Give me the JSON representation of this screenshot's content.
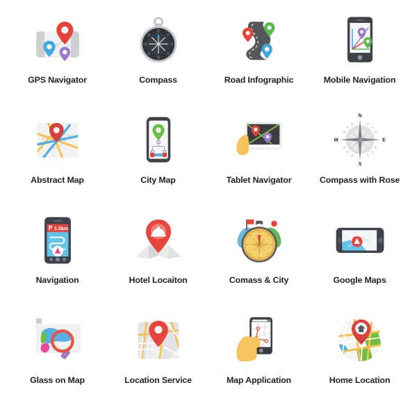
{
  "grid": {
    "columns": 4,
    "rows": 4,
    "background_color": "#ffffff",
    "label_color": "#231f20"
  },
  "icons": [
    {
      "label": "GPS Navigator",
      "icon_name": "gps-navigator-icon",
      "description": "Folded paper map with three location pins",
      "colors": [
        "#E8413A",
        "#3FA9E0",
        "#9B7CC4",
        "#EEEFF0",
        "#C9CCCF"
      ]
    },
    {
      "label": "Compass",
      "icon_name": "compass-icon",
      "description": "Dark round pocket compass with silver rim and hanging ring",
      "colors": [
        "#2E3338",
        "#C6CACD",
        "#3C93D8"
      ]
    },
    {
      "label": "Road Infographic",
      "icon_name": "road-infographic-icon",
      "description": "Winding grey road with red, green and blue pins",
      "colors": [
        "#54585C",
        "#E8413A",
        "#5BBA47",
        "#3FA9E0"
      ]
    },
    {
      "label": "Mobile Navigation",
      "icon_name": "mobile-navigation-icon",
      "description": "Dark smartphone showing route lines with purple and green pins",
      "colors": [
        "#3E4349",
        "#F5F6F7",
        "#9B7CC4",
        "#5BBA47",
        "#E8413A"
      ]
    },
    {
      "label": "Abstract Map",
      "icon_name": "abstract-map-icon",
      "description": "Street map tile with yellow and blue roads and a red pin",
      "colors": [
        "#F2F2F1",
        "#F6C14B",
        "#56AEE2",
        "#D8413C"
      ]
    },
    {
      "label": "City Map",
      "icon_name": "city-map-icon",
      "description": "Smartphone showing a green pin over a transit diagram",
      "colors": [
        "#3E4349",
        "#6CBE45",
        "#56AEE2",
        "#E8413A",
        "#9B7CC4"
      ]
    },
    {
      "label": "Tablet Navigator",
      "icon_name": "tablet-navigator-icon",
      "description": "Hand touching a tablet with a route and two pins",
      "colors": [
        "#3A3E43",
        "#F7C35C",
        "#E8413A",
        "#9B7CC4",
        "#8CC63F"
      ]
    },
    {
      "label": "Compass with Rose",
      "icon_name": "compass-with-rose-icon",
      "description": "Grayscale compass rose with N E S W markings",
      "colors": [
        "#D7D8DA",
        "#808285",
        "#231f20"
      ]
    },
    {
      "label": "Navigation",
      "icon_name": "navigation-icon",
      "description": "Smartphone with turn banner, route path and direction arrow",
      "colors": [
        "#3E4349",
        "#E8413A",
        "#62C3E8",
        "#E8479B"
      ],
      "screen_text": "1.5km"
    },
    {
      "label": "Hotel Locaiton",
      "icon_name": "hotel-location-icon",
      "description": "Red pin with food cloche over a folded white map",
      "colors": [
        "#E8453F",
        "#E9EAEB",
        "#CED1D4"
      ]
    },
    {
      "label": "Comass & City",
      "icon_name": "compass-and-city-icon",
      "description": "Golden compass in front of blue and green land shapes with a red flag",
      "colors": [
        "#F4D06A",
        "#E0B54F",
        "#6FB7DD",
        "#63B75B",
        "#E8413A",
        "#58595B"
      ]
    },
    {
      "label": "Google Maps",
      "icon_name": "google-maps-icon",
      "description": "Landscape smartphone showing a blue map with a red navigation marker",
      "colors": [
        "#3E4349",
        "#62C3E8",
        "#FFFFFF",
        "#E8453F"
      ]
    },
    {
      "label": "Glass on Map",
      "icon_name": "glass-on-map-icon",
      "description": "World map with a red magnifying glass and purple handle",
      "colors": [
        "#F0F0EF",
        "#56AEE2",
        "#6CBE45",
        "#EC4899",
        "#E8543F",
        "#9B7CC4"
      ]
    },
    {
      "label": "Location Service",
      "icon_name": "location-service-icon",
      "description": "Street map tile with a red location pin",
      "colors": [
        "#EFEFEF",
        "#F6C14B",
        "#D2D3D5",
        "#E8453F"
      ]
    },
    {
      "label": "Map Application",
      "icon_name": "map-application-icon",
      "description": "Hand holding a smartphone showing a map with route points",
      "colors": [
        "#F7C35C",
        "#3A3E43",
        "#FFFFFF",
        "#E8453F"
      ]
    },
    {
      "label": "Home Location",
      "icon_name": "home-location-icon",
      "description": "Circular map with roads, green parks, water and a red home pin",
      "colors": [
        "#F5F5F4",
        "#F6C14B",
        "#6CBE45",
        "#56AEE2",
        "#D8413C"
      ]
    }
  ]
}
